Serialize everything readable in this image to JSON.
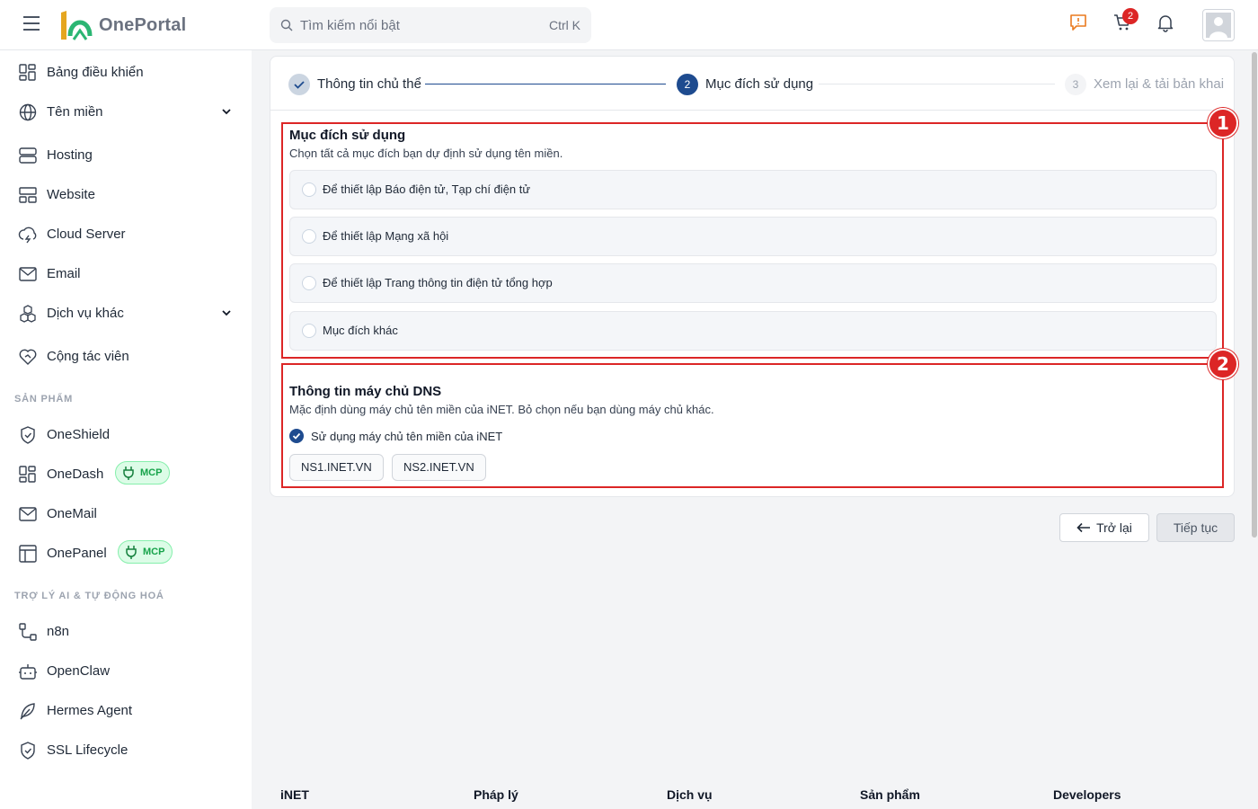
{
  "header": {
    "app_name": "OnePortal",
    "search_placeholder": "Tìm kiếm nổi bật",
    "search_shortcut": "Ctrl K",
    "cart_count": "2"
  },
  "sidebar": {
    "items": [
      {
        "label": "Bảng điều khiển"
      },
      {
        "label": "Tên miền"
      },
      {
        "label": "Hosting"
      },
      {
        "label": "Website"
      },
      {
        "label": "Cloud Server"
      },
      {
        "label": "Email"
      },
      {
        "label": "Dịch vụ khác"
      },
      {
        "label": "Cộng tác viên"
      }
    ],
    "products_title": "SẢN PHẨM",
    "products": [
      {
        "label": "OneShield"
      },
      {
        "label": "OneDash",
        "badge": "MCP"
      },
      {
        "label": "OneMail"
      },
      {
        "label": "OnePanel",
        "badge": "MCP"
      }
    ],
    "ai_title": "TRỢ LÝ AI & TỰ ĐỘNG HOÁ",
    "ai_items": [
      {
        "label": "n8n"
      },
      {
        "label": "OpenClaw"
      },
      {
        "label": "Hermes Agent"
      },
      {
        "label": "SSL Lifecycle"
      }
    ]
  },
  "stepper": {
    "steps": [
      {
        "number": "1",
        "label": "Thông tin chủ thể",
        "state": "done"
      },
      {
        "number": "2",
        "label": "Mục đích sử dụng",
        "state": "active"
      },
      {
        "number": "3",
        "label": "Xem lại & tải bản khai",
        "state": "pending"
      }
    ]
  },
  "purpose": {
    "title": "Mục đích sử dụng",
    "description": "Chọn tất cả mục đích bạn dự định sử dụng tên miền.",
    "options": [
      {
        "label": "Để thiết lập Báo điện tử, Tạp chí điện tử",
        "checked": false
      },
      {
        "label": "Để thiết lập Mạng xã hội",
        "checked": false
      },
      {
        "label": "Để thiết lập Trang thông tin điện tử tổng hợp",
        "checked": false
      },
      {
        "label": "Mục đích khác",
        "checked": false
      }
    ]
  },
  "dns": {
    "title": "Thông tin máy chủ DNS",
    "description": "Mặc định dùng máy chủ tên miền của iNET. Bỏ chọn nếu bạn dùng máy chủ khác.",
    "use_inet_label": "Sử dụng máy chủ tên miền của iNET",
    "use_inet_checked": true,
    "servers": [
      "NS1.INET.VN",
      "NS2.INET.VN"
    ]
  },
  "annotations": [
    "1",
    "2"
  ],
  "actions": {
    "back_label": "Trở lại",
    "next_label": "Tiếp tục"
  },
  "footer": {
    "columns": [
      "iNET",
      "Pháp lý",
      "Dịch vụ",
      "Sản phẩm",
      "Developers"
    ]
  },
  "colors": {
    "accent": "#1e4b8f",
    "annotation": "#dc2626",
    "mcp_green": "#16a34a"
  }
}
